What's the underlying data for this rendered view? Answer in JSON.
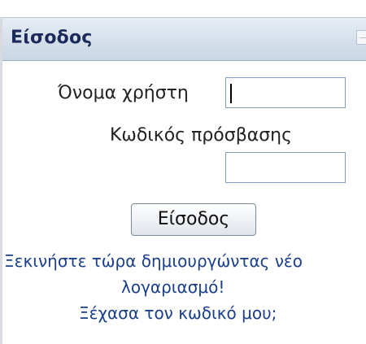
{
  "login_block": {
    "title": "Είσοδος",
    "username_label": "Όνομα χρήστη",
    "username_value": "",
    "password_label": "Κωδικός πρόσβασης",
    "password_value": "",
    "submit_label": "Είσοδος",
    "signup_link_line1": "Ξεκινήστε τώρα δημιουργώντας νέο",
    "signup_link_line2": "λογαριασμό!",
    "forgot_link": "Ξέχασα τον κωδικό μου;",
    "icons": {
      "collapse": "minus-box-icon"
    }
  },
  "colors": {
    "header_text": "#1b2a5a",
    "link": "#1a3f8a",
    "input_border": "#7f9db9"
  }
}
